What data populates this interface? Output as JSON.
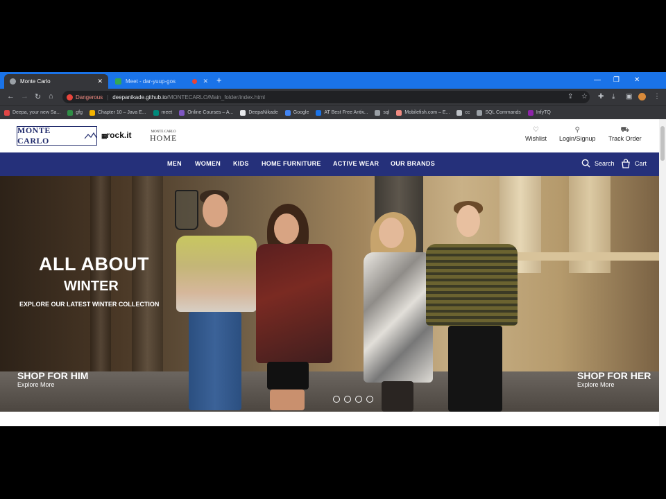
{
  "browser": {
    "tabs": [
      {
        "title": "Monte Carlo",
        "active": true
      },
      {
        "title": "Meet - dar-yuup-gos",
        "active": false
      }
    ],
    "security_label": "Dangerous",
    "url_host": "deepanikade.github.io",
    "url_path": "/MONTECARLO/Main_folder/index.html",
    "bookmarks": [
      {
        "label": "Deepa, your new Sa...",
        "color": "#e04545"
      },
      {
        "label": "gfg",
        "color": "#2f8d46"
      },
      {
        "label": "Chapter 10 – Java E...",
        "color": "#f4b400"
      },
      {
        "label": "meet",
        "color": "#00897b"
      },
      {
        "label": "Online Courses – A...",
        "color": "#7e57c2"
      },
      {
        "label": "DeepaNikade",
        "color": "#e8eaed"
      },
      {
        "label": "Google",
        "color": "#4285f4"
      },
      {
        "label": "AT Best Free Antiv...",
        "color": "#1a73e8"
      },
      {
        "label": "sql",
        "color": "#9aa0a6"
      },
      {
        "label": "Mobilefish.com – E...",
        "color": "#f28b82"
      },
      {
        "label": "cc",
        "color": "#bdc1c6"
      },
      {
        "label": "SQL Commands",
        "color": "#9aa0a6"
      },
      {
        "label": "InfyTQ",
        "color": "#8e24aa"
      }
    ]
  },
  "site": {
    "logos": {
      "brand": "MONTE CARLO",
      "rock": "rock.it",
      "home_small": "MONTE CARLO",
      "home_big": "HOME"
    },
    "header_actions": [
      {
        "label": "Wishlist",
        "icon": "heart-icon"
      },
      {
        "label": "Login/Signup",
        "icon": "user-icon"
      },
      {
        "label": "Track Order",
        "icon": "truck-icon"
      }
    ],
    "nav": [
      "MEN",
      "WOMEN",
      "KIDS",
      "HOME FURNITURE",
      "ACTIVE WEAR",
      "OUR BRANDS"
    ],
    "search_label": "Search",
    "cart_label": "Cart",
    "accent_color": "#25307a",
    "hero": {
      "title": "ALL ABOUT",
      "subtitle": "WINTER",
      "tagline": "EXPLORE OUR LATEST WINTER COLLECTION",
      "left_cta": {
        "title": "SHOP FOR HIM",
        "sub": "Explore More"
      },
      "right_cta": {
        "title": "SHOP FOR HER",
        "sub": "Explore More"
      },
      "slide_count": 4
    }
  }
}
